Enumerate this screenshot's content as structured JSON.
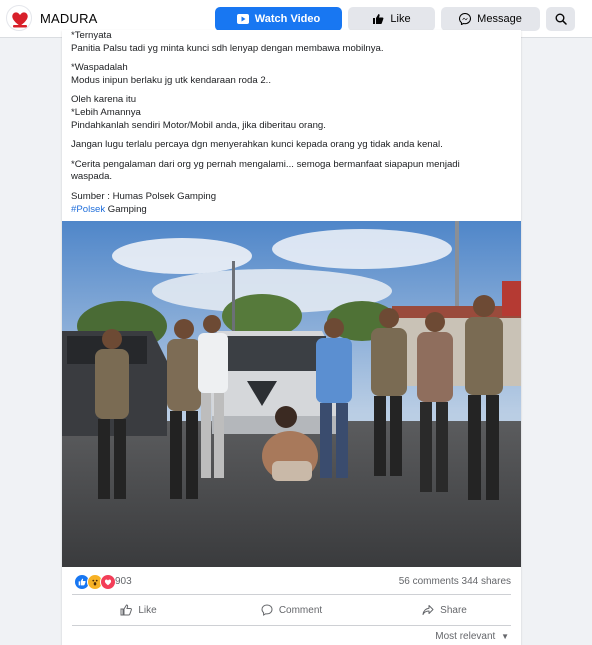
{
  "header": {
    "page_name": "MADURA",
    "watch_video_label": "Watch Video",
    "like_label": "Like",
    "message_label": "Message"
  },
  "post": {
    "paragraphs": [
      {
        "lines": [
          "*Ternyata",
          "Panitia Palsu tadi yg minta kunci sdh lenyap dengan membawa mobilnya."
        ]
      },
      {
        "lines": [
          "*Waspadalah",
          "Modus inipun berlaku jg utk kendaraan roda 2.."
        ]
      },
      {
        "lines": [
          "Oleh karena itu",
          "*Lebih Amannya",
          "Pindahkanlah sendiri Motor/Mobil anda, jika diberitau orang."
        ]
      },
      {
        "lines": [
          "Jangan lugu terlalu percaya dgn menyerahkan kunci kepada orang yg tidak anda kenal."
        ]
      },
      {
        "lines": [
          "*Cerita pengalaman dari org yg pernah mengalami... semoga bermanfaat  siapapun menjadi",
          "waspada."
        ]
      }
    ],
    "source_label": "Sumber : Humas Polsek Gamping",
    "hashtag": "#Polsek",
    "hashtag_suffix": " Gamping"
  },
  "stats": {
    "reaction_count": "903",
    "comments_shares": "56 comments  344 shares"
  },
  "actions": {
    "like": "Like",
    "comment": "Comment",
    "share": "Share"
  },
  "sort_label": "Most relevant",
  "colors": {
    "brand_blue": "#1877f2",
    "button_gray": "#e4e6eb",
    "meta_text": "#65676b"
  }
}
